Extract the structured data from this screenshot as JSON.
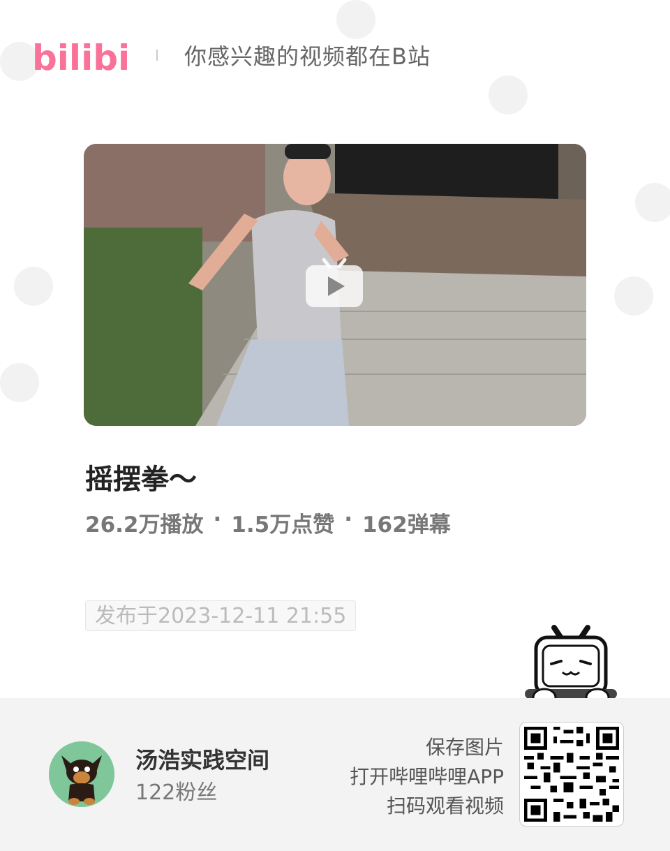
{
  "header": {
    "logo_text": "bilibili",
    "slogan": "你感兴趣的视频都在B站"
  },
  "video": {
    "title": "摇摆拳～",
    "views": "26.2万播放",
    "likes": "1.5万点赞",
    "danmaku": "162弹幕",
    "separator": "·",
    "publish_date": "发布于2023-12-11 21:55"
  },
  "uploader": {
    "name": "汤浩实践空间",
    "fans": "122粉丝"
  },
  "cta": {
    "line1": "保存图片",
    "line2": "打开哔哩哔哩APP",
    "line3": "扫码观看视频"
  },
  "colors": {
    "brand_pink": "#fb7299",
    "footer_bg": "#f3f3f3"
  },
  "icons": [
    "bilibili-logo",
    "play-icon",
    "tv-mascot-icon",
    "qr-code",
    "avatar-dog"
  ]
}
